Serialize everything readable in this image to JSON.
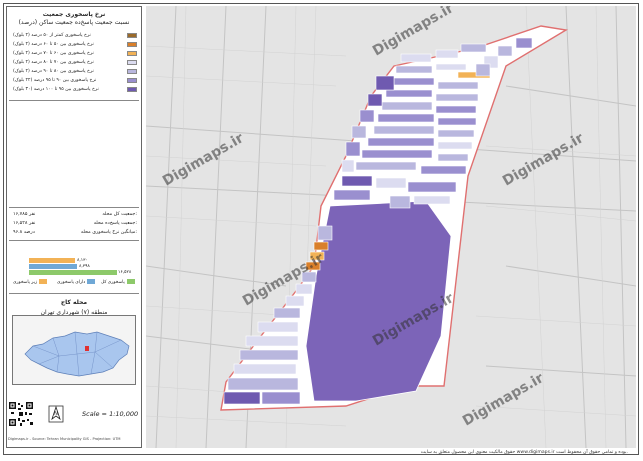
{
  "legend": {
    "title_line1": "نرخ پاسخوری جمعیت",
    "title_line2": "نسبت جمعیت پاسخ‌ده جمعیت ساکن (درصد)",
    "items": [
      {
        "label": "نرخ پاسخوری کمتر از ۵۰ درصد (۲ بلوک)",
        "color": "#9a6a2a"
      },
      {
        "label": "نرخ پاسخوری بین ۵۰ تا ۶۰ درصد (۲ بلوک)",
        "color": "#d97f2a"
      },
      {
        "label": "نرخ پاسخوری بین ۶۰ تا ۷۰ درصد (۲ بلوک)",
        "color": "#f2b256"
      },
      {
        "label": "نرخ پاسخوری بین ۷۰ تا ۸۰ درصد (۲ بلوک)",
        "color": "#dcdcf0"
      },
      {
        "label": "نرخ پاسخوری بین ۸۰ تا ۹۰ درصد (۲ بلوک)",
        "color": "#b9b7de"
      },
      {
        "label": "نرخ پاسخوری بین ۹۰ تا ۹۵ درصد (۲۲ بلوک)",
        "color": "#9a8fcf"
      },
      {
        "label": "نرخ پاسخوری بین ۹۵ تا ۱۰۰ درصد (۳۰ بلوک)",
        "color": "#6f5ab0"
      }
    ]
  },
  "stats": [
    {
      "label": "جمعیت کل محله:",
      "value": "۱۶,۷۸۵ نفر"
    },
    {
      "label": "جمعیت پاسخ‌ده محله:",
      "value": "۱۶,۵۲۸ نفر"
    },
    {
      "label": "میانگین نرخ پاسخوری محله:",
      "value": "۹۶.۸ درصد"
    }
  ],
  "bars": {
    "values": [
      {
        "name": "زیر پاسخوری",
        "value": "۸,۱۳۰",
        "fraction": 0.49,
        "color": "#f2b256"
      },
      {
        "name": "دارای پاسخوری",
        "value": "۸,۳۹۸",
        "fraction": 0.51,
        "color": "#6fa8d6"
      },
      {
        "name": "پاسخوری کل",
        "value": "۱۶,۵۲۸",
        "fraction": 1.0,
        "color": "#8dc96a"
      }
    ]
  },
  "inset": {
    "title": "محله کاج",
    "subtitle": "منطقه (۷) شهرداری تهران"
  },
  "scale": "Scale = 1:10,000",
  "north": "N",
  "footer_left": "Digimaps.ir - Source: Tehran Municipality GIS - Projection: UTM",
  "footer_right": "حقوق مالکیت معنوی این محصول متعلق به سایت www.digimaps.ir بوده و تمامی حقوق آن محفوظ است.",
  "watermark": "Digimaps.ir"
}
